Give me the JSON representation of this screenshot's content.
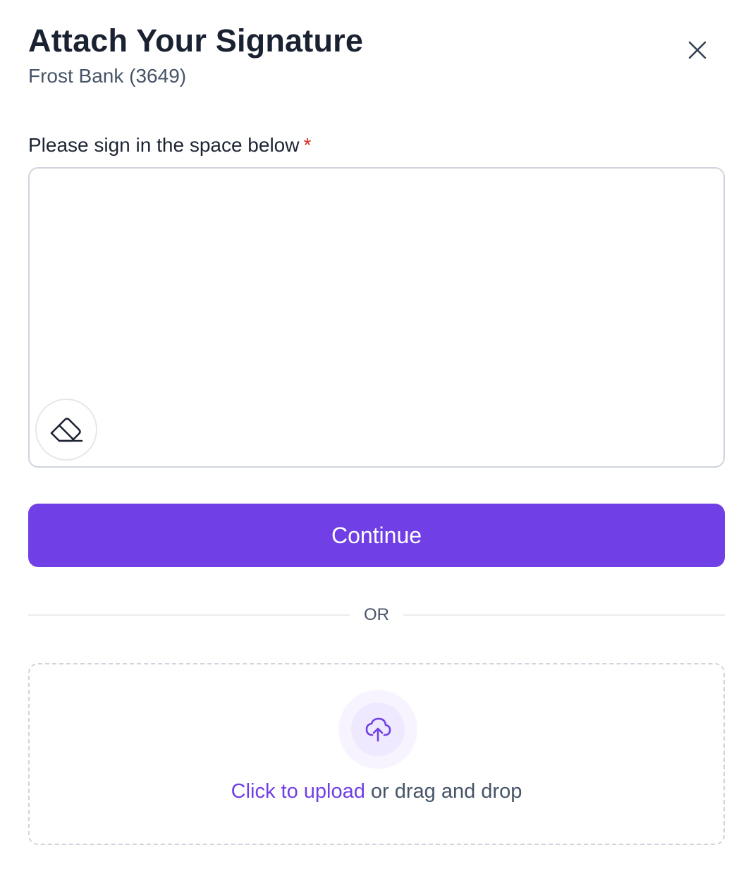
{
  "modal": {
    "title": "Attach Your Signature",
    "subtitle": "Frost Bank (3649)",
    "close_icon": "close-icon"
  },
  "signature": {
    "label": "Please sign in the space below",
    "required_marker": "*",
    "eraser_icon": "eraser-icon"
  },
  "actions": {
    "continue_label": "Continue"
  },
  "divider": {
    "label": "OR"
  },
  "upload": {
    "icon": "cloud-upload-icon",
    "link_text": "Click to upload",
    "rest_text": " or drag and drop"
  },
  "colors": {
    "accent": "#7040e6",
    "required": "#d92d20",
    "title": "#1a2232",
    "muted": "#475467",
    "border": "#d0d5dd"
  }
}
